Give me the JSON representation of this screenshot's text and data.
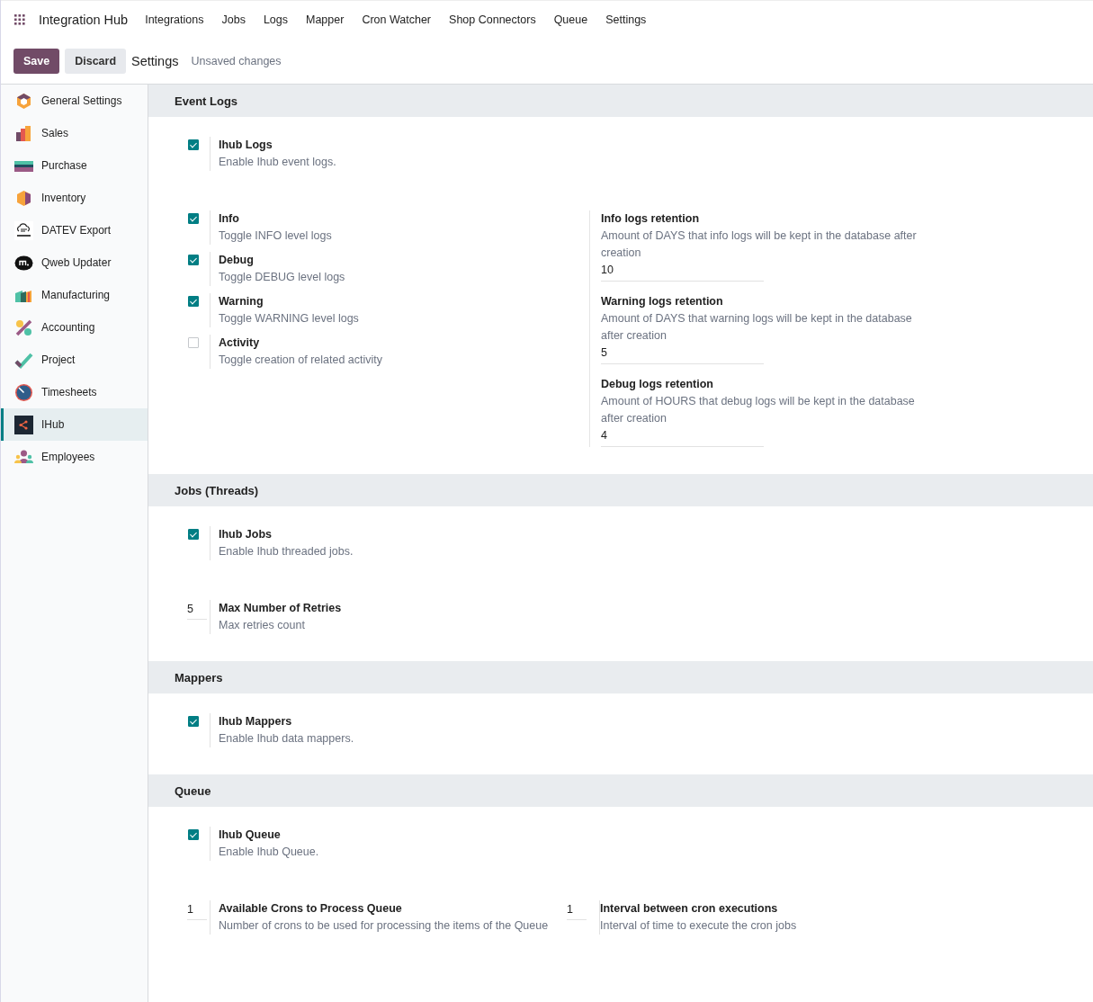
{
  "app": {
    "title": "Integration Hub",
    "menu": [
      "Integrations",
      "Jobs",
      "Logs",
      "Mapper",
      "Cron Watcher",
      "Shop Connectors",
      "Queue",
      "Settings"
    ]
  },
  "control_panel": {
    "save": "Save",
    "discard": "Discard",
    "breadcrumb": "Settings",
    "status": "Unsaved changes"
  },
  "sidebar": {
    "items": [
      {
        "label": "General Settings",
        "selected": false
      },
      {
        "label": "Sales",
        "selected": false
      },
      {
        "label": "Purchase",
        "selected": false
      },
      {
        "label": "Inventory",
        "selected": false
      },
      {
        "label": "DATEV Export",
        "selected": false
      },
      {
        "label": "Qweb Updater",
        "selected": false
      },
      {
        "label": "Manufacturing",
        "selected": false
      },
      {
        "label": "Accounting",
        "selected": false
      },
      {
        "label": "Project",
        "selected": false
      },
      {
        "label": "Timesheets",
        "selected": false
      },
      {
        "label": "IHub",
        "selected": true
      },
      {
        "label": "Employees",
        "selected": false
      }
    ]
  },
  "sections": [
    {
      "title": "Event Logs",
      "rows": [
        {
          "left": [
            {
              "kind": "checkbox",
              "label": "Ihub Logs",
              "description": "Enable Ihub event logs.",
              "checked": true
            }
          ],
          "right": []
        },
        {
          "left": [
            {
              "kind": "checkbox",
              "label": "Info",
              "description": "Toggle INFO level logs",
              "checked": true
            },
            {
              "kind": "checkbox",
              "label": "Debug",
              "description": "Toggle DEBUG level logs",
              "checked": true
            },
            {
              "kind": "checkbox",
              "label": "Warning",
              "description": "Toggle WARNING level logs",
              "checked": true
            },
            {
              "kind": "checkbox",
              "label": "Activity",
              "description": "Toggle creation of related activity",
              "checked": false
            }
          ],
          "right": [
            {
              "kind": "field",
              "label": "Info logs retention",
              "description": "Amount of DAYS that info logs will be kept in the database after creation",
              "value": "10"
            },
            {
              "kind": "field",
              "label": "Warning logs retention",
              "description": "Amount of DAYS that warning logs will be kept in the database after creation",
              "value": "5"
            },
            {
              "kind": "field",
              "label": "Debug logs retention",
              "description": "Amount of HOURS that debug logs will be kept in the database after creation",
              "value": "4"
            }
          ]
        }
      ]
    },
    {
      "title": "Jobs (Threads)",
      "rows": [
        {
          "left": [
            {
              "kind": "checkbox",
              "label": "Ihub Jobs",
              "description": "Enable Ihub threaded jobs.",
              "checked": true
            }
          ],
          "right": []
        },
        {
          "left": [
            {
              "kind": "count",
              "label": "Max Number of Retries",
              "description": "Max retries count",
              "value": "5"
            }
          ],
          "right": []
        }
      ]
    },
    {
      "title": "Mappers",
      "rows": [
        {
          "left": [
            {
              "kind": "checkbox",
              "label": "Ihub Mappers",
              "description": "Enable Ihub data mappers.",
              "checked": true
            }
          ],
          "right": []
        }
      ]
    },
    {
      "title": "Queue",
      "rows": [
        {
          "left": [
            {
              "kind": "checkbox",
              "label": "Ihub Queue",
              "description": "Enable Ihub Queue.",
              "checked": true
            }
          ],
          "right": []
        },
        {
          "left": [
            {
              "kind": "count",
              "label": "Available Crons to Process Queue",
              "description": "Number of crons to be used for processing the items of the Queue",
              "value": "1"
            }
          ],
          "right": [
            {
              "kind": "count",
              "label": "Interval between cron executions",
              "description": "Interval of time to execute the cron jobs",
              "value": "1"
            }
          ]
        }
      ]
    }
  ]
}
